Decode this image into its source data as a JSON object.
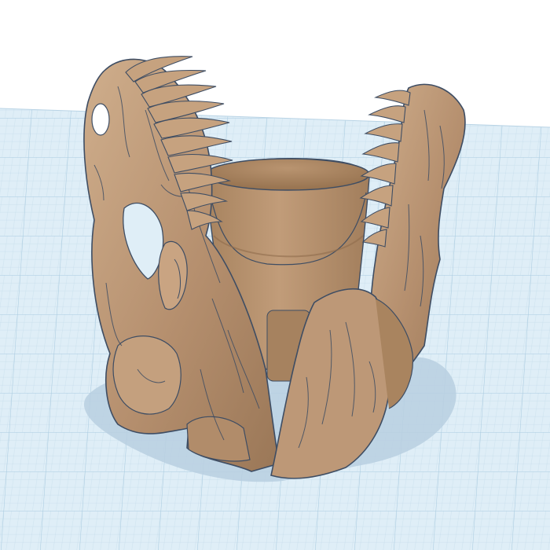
{
  "scene": {
    "view": "3d-workplane",
    "object": "t-rex-skull-planter",
    "colors": {
      "background": "#ffffff",
      "workplane": "#dfeef7",
      "grid_minor": "#c3dbea",
      "grid_major": "#a9cbe0",
      "model_base": "#b58f6e",
      "model_light": "#d2b190",
      "model_dark": "#8a6a4e",
      "model_shadow_interior": "#9d7b5c",
      "model_outline": "#3e4d63",
      "ground_shadow": "#b9cfe0"
    }
  }
}
